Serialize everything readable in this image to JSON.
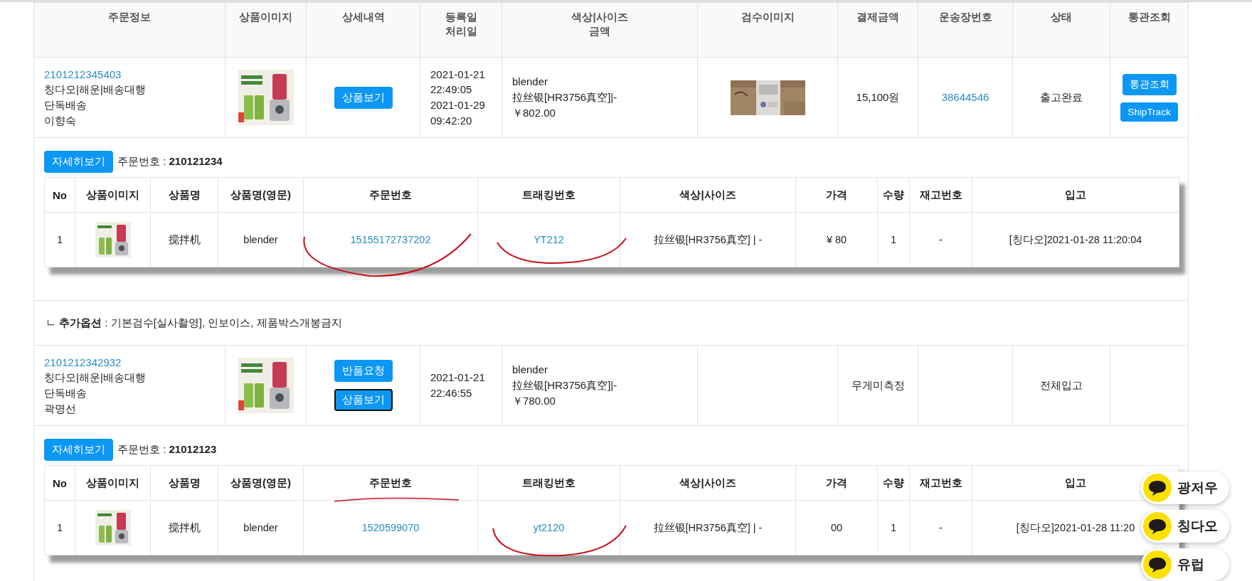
{
  "columns": [
    [
      "주문정보"
    ],
    [
      "상품이미지"
    ],
    [
      "상세내역"
    ],
    [
      "등록일",
      "처리일"
    ],
    [
      "색상|사이즈",
      "금액"
    ],
    [
      "검수이미지"
    ],
    [
      "결제금액"
    ],
    [
      "운송장번호"
    ],
    [
      "상태"
    ],
    [
      "통관조회"
    ]
  ],
  "orders": [
    {
      "order_no": "2101212345403",
      "info": [
        "칭다오|해운|배송대행",
        "단독배송",
        "이향숙"
      ],
      "image": {
        "kind": "picture"
      },
      "actions": [
        {
          "label": "상품보기",
          "focused": false
        }
      ],
      "dates": [
        "2021-01-21",
        "22:49:05",
        "2021-01-29",
        "09:42:20"
      ],
      "product": [
        "blender",
        "拉丝银[HR3756真空]|-",
        "￥802.00"
      ],
      "inspection_image": {
        "kind": "picture"
      },
      "payment": "15,100원",
      "waybill": "38644546",
      "status": "출고완료",
      "customs": [
        "통관조회",
        "ShipTrack"
      ],
      "detail": {
        "button": "자세히보기",
        "title": "주문번호 : **210121234**",
        "columns": [
          "No",
          "상품이미지",
          "상품명",
          "상품명(영문)",
          "주문번호",
          "트래킹번호",
          "색상|사이즈",
          "가격",
          "수량",
          "재고번호",
          "입고"
        ],
        "rows": [
          {
            "no": "1",
            "image": {
              "kind": "picture"
            },
            "name": "搅拌机",
            "name_en": "blender",
            "order_no": "15155172737202",
            "tracking": "YT212",
            "option": "拉丝银[HR3756真空] | -",
            "price": "¥ 80",
            "qty": "1",
            "stock_no": "-",
            "inbound": "[칭다오]2021-01-28 11:20:04"
          }
        ]
      },
      "extra_options": "ㄴ **추가옵션** : 기본검수[실사촬영], 인보이스, 제품박스개봉금지"
    },
    {
      "order_no": "2101212342932",
      "info": [
        "칭다오|해운|배송대행",
        "단독배송",
        "곽명선"
      ],
      "image": {
        "kind": "picture"
      },
      "actions": [
        {
          "label": "반품요청",
          "focused": false
        },
        {
          "label": "상품보기",
          "focused": true
        }
      ],
      "dates": [
        "2021-01-21",
        "22:46:55"
      ],
      "product": [
        "blender",
        "拉丝银[HR3756真空]|-",
        "￥780.00"
      ],
      "payment": "무게미측정",
      "status": "전체입고",
      "detail": {
        "button": "자세히보기",
        "title": "주문번호 : **21012123**",
        "columns": [
          "No",
          "상품이미지",
          "상품명",
          "상품명(영문)",
          "주문번호",
          "트래킹번호",
          "색상|사이즈",
          "가격",
          "수량",
          "재고번호",
          "입고"
        ],
        "rows": [
          {
            "no": "1",
            "image": {
              "kind": "picture"
            },
            "name": "搅拌机",
            "name_en": "blender",
            "order_no": "1520599070",
            "tracking": "yt2120",
            "option": "拉丝银[HR3756真空] | -",
            "price": "00",
            "qty": "1",
            "stock_no": "-",
            "inbound": "[칭다오]2021-01-28 11:20"
          }
        ]
      }
    }
  ],
  "quick_links": [
    {
      "label": "광저우"
    },
    {
      "label": "칭다오"
    },
    {
      "label": "유럽"
    }
  ]
}
